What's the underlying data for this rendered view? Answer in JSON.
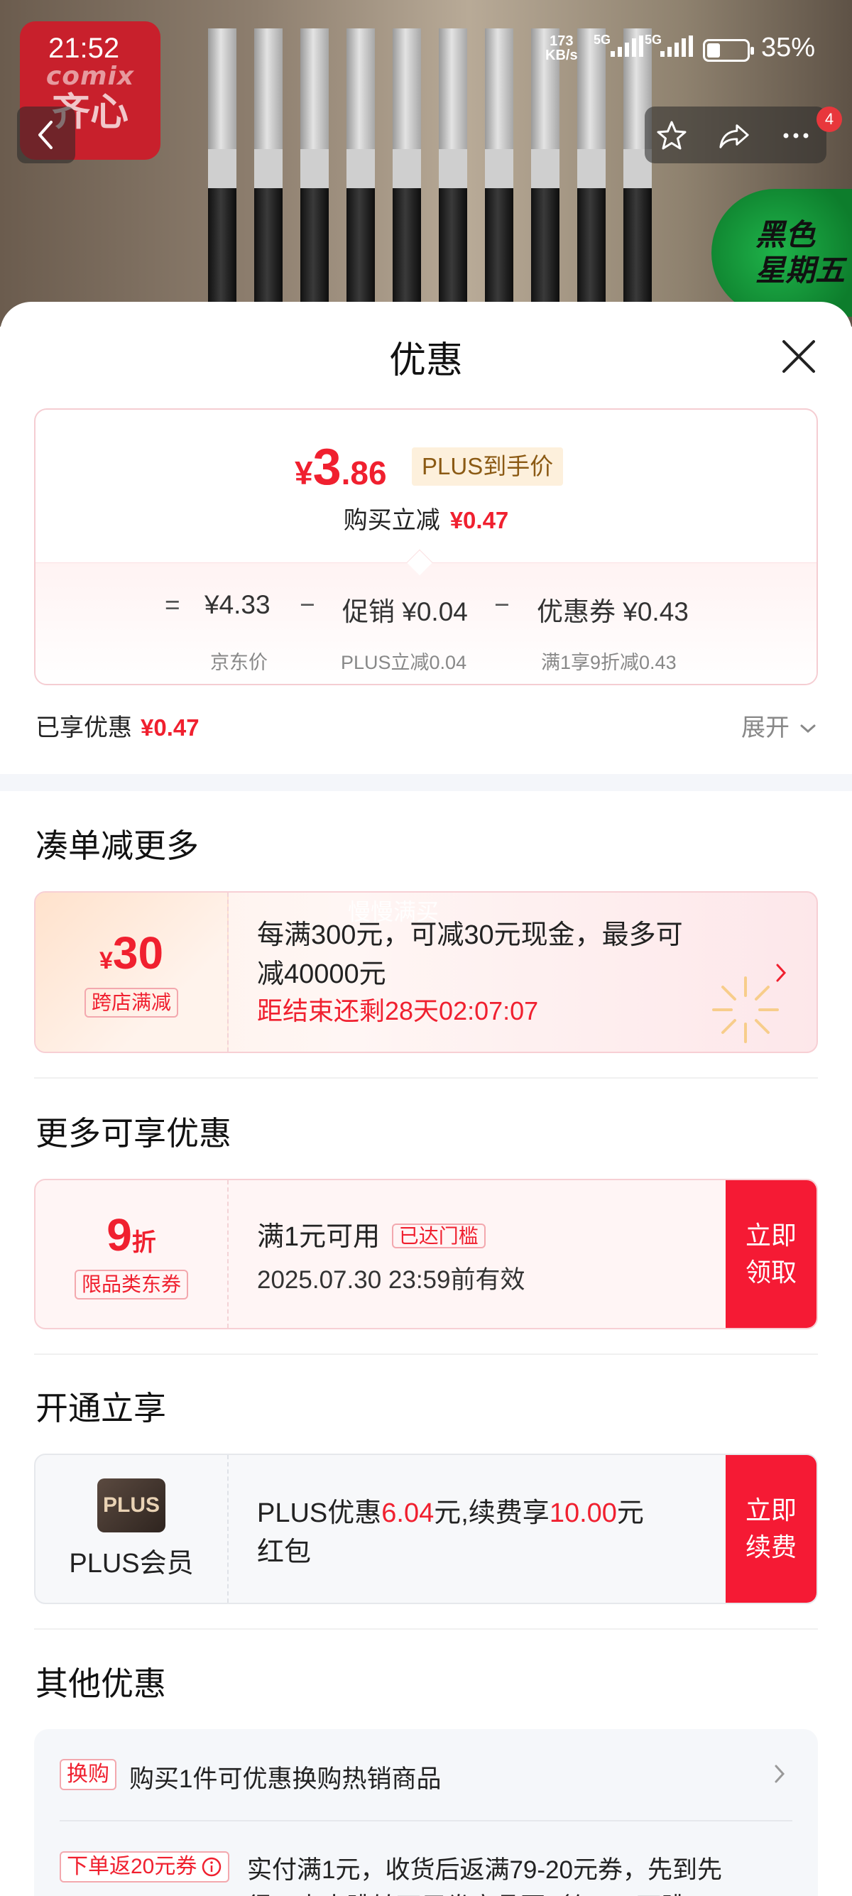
{
  "status_bar": {
    "time": "21:52",
    "net_speed_value": "173",
    "net_speed_unit": "KB/s",
    "sig1": "5G",
    "sig2": "5G",
    "battery": "35%"
  },
  "hero": {
    "logo_en": "comix",
    "logo_zh": "齐心",
    "promo_line1": "黑色",
    "promo_line2": "星期五",
    "badge_count": "4"
  },
  "sheet": {
    "title": "优惠",
    "price": {
      "yen": "¥",
      "integer": "3",
      "decimal": ".86",
      "plus_tag": "PLUS到手价",
      "sub_label": "购买立减",
      "sub_value": "¥0.47",
      "eq": "=",
      "jd_price": "¥4.33",
      "minus1": "−",
      "promo_label": "促销",
      "promo_value": "¥0.04",
      "minus2": "−",
      "coupon_label": "优惠券",
      "coupon_value": "¥0.43",
      "jd_price_caption": "京东价",
      "promo_caption": "PLUS立减0.04",
      "coupon_caption": "满1享9折减0.43"
    },
    "enjoyed_label": "已享优惠",
    "enjoyed_value": "¥0.47",
    "expand_label": "展开",
    "section1": {
      "title": "凑单减更多",
      "amount_yen": "¥",
      "amount": "30",
      "tag": "跨店满减",
      "watermark": "慢慢满买",
      "line1": "每满300元，可减30元现金，最多可",
      "line2": "减40000元",
      "countdown": "距结束还剩28天02:07:07"
    },
    "section2": {
      "title": "更多可享优惠",
      "discount": "9",
      "discount_unit": "折",
      "tag": "限品类东券",
      "line1": "满1元可用",
      "badge": "已达门槛",
      "line2": "2025.07.30 23:59前有效",
      "btn_line1": "立即",
      "btn_line2": "领取"
    },
    "section3": {
      "title": "开通立享",
      "logo": "PLUS",
      "member_label": "PLUS会员",
      "t1": "PLUS优惠",
      "v1": "6.04",
      "t2": "元,续费享",
      "v2": "10.00",
      "t3": "元",
      "line2": "红包",
      "btn_line1": "立即",
      "btn_line2": "续费"
    },
    "section4": {
      "title": "其他优惠",
      "row1_tag": "换购",
      "row1_text": "购买1件可优惠换购热销商品",
      "row2_tag": "下单返20元券",
      "row2_line1": "实付满1元，收货后返满79-20元券，先到先",
      "row2_line2": "得，点击跳转可用券商品页（仅app可跳"
    }
  },
  "colors": {
    "accent_red": "#f0202f",
    "button_red": "#f51a34",
    "plus_gold": "#8b5a14"
  }
}
